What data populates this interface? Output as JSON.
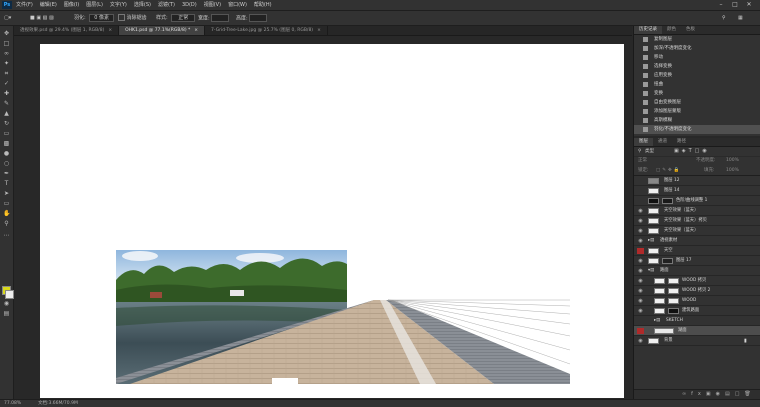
{
  "menubar": {
    "logo": "Ps",
    "menus": [
      "文件(F)",
      "编辑(E)",
      "图像(I)",
      "图层(L)",
      "文字(Y)",
      "选择(S)",
      "滤镜(T)",
      "3D(D)",
      "视图(V)",
      "窗口(W)",
      "帮助(H)"
    ]
  },
  "options": {
    "feather_label": "羽化:",
    "feather_value": "0 像素",
    "antialias_label": "消除锯齿",
    "style_label": "样式:",
    "style_value": "正常",
    "width_label": "宽度:",
    "height_label": "高度:"
  },
  "tabs": [
    {
      "label": "透视效果.psd @ 29.4% (图层 1, RGB/8)",
      "active": false
    },
    {
      "label": "OHK1.psd @ 77.1%(RGB/8) *",
      "active": true
    },
    {
      "label": "7-Grid-Tree-Lake.jpg @ 25.7% (图层 0, RGB/8)",
      "active": false
    }
  ],
  "status": {
    "zoom": "77.08%",
    "doc": "文档:3.66M/70.9M"
  },
  "history_panel": {
    "tabs": [
      "历史记录",
      "颜色",
      "色板"
    ],
    "items": [
      "复制图层",
      "加深/不透明度变化",
      "移动",
      "选择变换",
      "应用变换",
      "扭曲",
      "变换",
      "自由变换图层",
      "添加图层蒙版",
      "高斯模糊",
      "羽化/不透明度变化"
    ],
    "active_index": 10
  },
  "layers_panel": {
    "tabs": [
      "图层",
      "通道",
      "路径"
    ],
    "filter_label": "类型",
    "blend_mode": "正常",
    "opacity_label": "不透明度:",
    "opacity_value": "100%",
    "lock_label": "锁定:",
    "fill_label": "填充:",
    "fill_value": "100%",
    "layers": [
      {
        "name": "图层 12",
        "indent": 0
      },
      {
        "name": "图层 14",
        "indent": 0
      },
      {
        "name": "色阶/曲线调整 1",
        "indent": 0
      },
      {
        "name": "天空效果（蓝天）",
        "indent": 0
      },
      {
        "name": "天空效果（蓝天）拷贝",
        "indent": 0
      },
      {
        "name": "天空效果（蓝天）",
        "indent": 0
      },
      {
        "name": "透视素材",
        "indent": 0
      },
      {
        "name": "天空",
        "indent": 0
      },
      {
        "name": "图层 17",
        "indent": 0
      },
      {
        "name": "路面",
        "indent": 0
      },
      {
        "name": "WOOD 拷贝",
        "indent": 1
      },
      {
        "name": "WOOD 拷贝 2",
        "indent": 1
      },
      {
        "name": "WOOD",
        "indent": 1
      },
      {
        "name": "建筑路面",
        "indent": 1
      },
      {
        "name": "SKETCH",
        "indent": 1
      },
      {
        "name": "湖面",
        "indent": 1
      },
      {
        "name": "背景",
        "indent": 0
      }
    ]
  }
}
